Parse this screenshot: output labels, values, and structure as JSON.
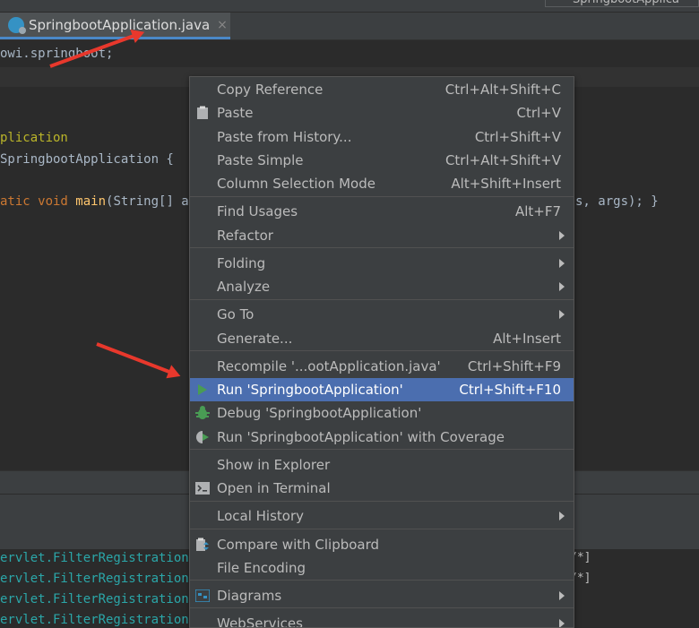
{
  "top_bar": {
    "run_config_label": "SpringbootApplica"
  },
  "tab": {
    "label": "SpringbootApplication.java",
    "close": "×"
  },
  "breadcrumb": {
    "text": "owi.springboot;"
  },
  "code": {
    "line1": "plication",
    "line2": "SpringbootApplication {",
    "line3_kw": "atic void ",
    "line3_fn": "main",
    "line3_rest": "(String[] arg",
    "line3_tail": "s, args); }"
  },
  "console": {
    "lines": [
      "ervlet.FilterRegistrationBe",
      "ervlet.FilterRegistrationBe",
      "ervlet.FilterRegistrationBe",
      "ervlet.FilterRegistrationBe"
    ],
    "right_lines": [
      "/*]",
      "/*]"
    ]
  },
  "menu": {
    "copy_reference": {
      "label": "Copy Reference",
      "shortcut": "Ctrl+Alt+Shift+C"
    },
    "paste": {
      "label": "Paste",
      "shortcut": "Ctrl+V"
    },
    "paste_history": {
      "label": "Paste from History...",
      "shortcut": "Ctrl+Shift+V"
    },
    "paste_simple": {
      "label": "Paste Simple",
      "shortcut": "Ctrl+Alt+Shift+V"
    },
    "column_selection": {
      "label": "Column Selection Mode",
      "shortcut": "Alt+Shift+Insert"
    },
    "find_usages": {
      "label": "Find Usages",
      "shortcut": "Alt+F7"
    },
    "refactor": {
      "label": "Refactor"
    },
    "folding": {
      "label": "Folding"
    },
    "analyze": {
      "label": "Analyze"
    },
    "go_to": {
      "label": "Go To"
    },
    "generate": {
      "label": "Generate...",
      "shortcut": "Alt+Insert"
    },
    "recompile": {
      "label": "Recompile '...ootApplication.java'",
      "shortcut": "Ctrl+Shift+F9"
    },
    "run": {
      "label": "Run 'SpringbootApplication'",
      "shortcut": "Ctrl+Shift+F10"
    },
    "debug": {
      "label": "Debug 'SpringbootApplication'"
    },
    "coverage": {
      "label": "Run 'SpringbootApplication' with Coverage"
    },
    "show_explorer": {
      "label": "Show in Explorer"
    },
    "open_terminal": {
      "label": "Open in Terminal"
    },
    "local_history": {
      "label": "Local History"
    },
    "compare_clipboard": {
      "label": "Compare with Clipboard"
    },
    "file_encoding": {
      "label": "File Encoding"
    },
    "diagrams": {
      "label": "Diagrams"
    },
    "webservices": {
      "label": "WebServices"
    }
  },
  "colors": {
    "selection": "#4b6eaf",
    "menu_bg": "#3c3f41",
    "run_green": "#499c54",
    "arrow_red": "#e8382c"
  }
}
